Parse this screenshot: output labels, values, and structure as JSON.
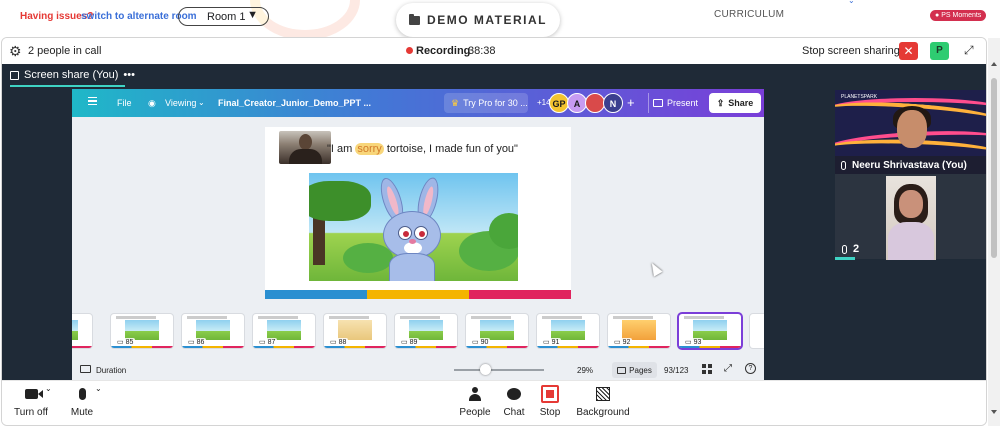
{
  "topbar": {
    "issues_text": "Having issues?",
    "switch_link": "switch to alternate room",
    "room_value": "Room 1",
    "room_arrow": "▼",
    "center_tab": "DEMO MATERIAL",
    "curriculum": "CURRICULUM",
    "moments_badge": "PS Moments"
  },
  "call": {
    "people_count": "2 people in call",
    "recording_label": "Recording",
    "recording_time": "38:38",
    "stop_share": "Stop screen sharing",
    "stop_share_icon": "✕",
    "avatar_letter": "P",
    "expand_icon": "⤢",
    "settings_icon": "⚙"
  },
  "share": {
    "label": "Screen share (You)",
    "more": "•••"
  },
  "canva": {
    "menu_file": "File",
    "view_mode": "Viewing",
    "view_chevron": "⌄",
    "eye_icon": "◉",
    "doc_title": "Final_Creator_Junior_Demo_PPT ...",
    "pro_label": "Try Pro for 30 ...",
    "crown_icon": "♛",
    "extra_collaborators": "+14",
    "collaborators": [
      {
        "initials": "GP",
        "color": "#f4c430"
      },
      {
        "initials": "A",
        "color": "#c79bf2"
      },
      {
        "initials": "",
        "color": "#d94a4a"
      },
      {
        "initials": "N",
        "color": "#3b3f8f"
      }
    ],
    "add_icon": "+",
    "present_label": "Present",
    "share_label": "Share",
    "share_icon": "⇪",
    "slide_quote_before": "\"I am ",
    "slide_quote_highlight": "sorry",
    "slide_quote_after": " tortoise, I made fun of you\"",
    "slide_bar_colors": [
      "#2a8fd1",
      "#f4b400",
      "#e0245e"
    ],
    "thumbnails": [
      {
        "num": ""
      },
      {
        "num": "85"
      },
      {
        "num": "86"
      },
      {
        "num": "87"
      },
      {
        "num": "88"
      },
      {
        "num": "89"
      },
      {
        "num": "90"
      },
      {
        "num": "91"
      },
      {
        "num": "92"
      },
      {
        "num": "93",
        "active": true
      }
    ],
    "duration_label": "Duration",
    "zoom": "29%",
    "zoom_level": 0.29,
    "pages_label": "Pages",
    "page_count": "93/123",
    "fullscreen_icon": "⤢",
    "help_icon": "?"
  },
  "participants": {
    "tile1_brand": "PLANETSPARK",
    "tile1_name": "Neeru Shrivastava (You)",
    "tile2_count": "2",
    "wave_colors": [
      "#ff4d8d",
      "#ffb13b",
      "#ff4d8d",
      "#ffb13b"
    ]
  },
  "controls": {
    "turn_off": "Turn off",
    "mute": "Mute",
    "people": "People",
    "chat": "Chat",
    "stop": "Stop",
    "background": "Background",
    "caret": "⌄"
  }
}
